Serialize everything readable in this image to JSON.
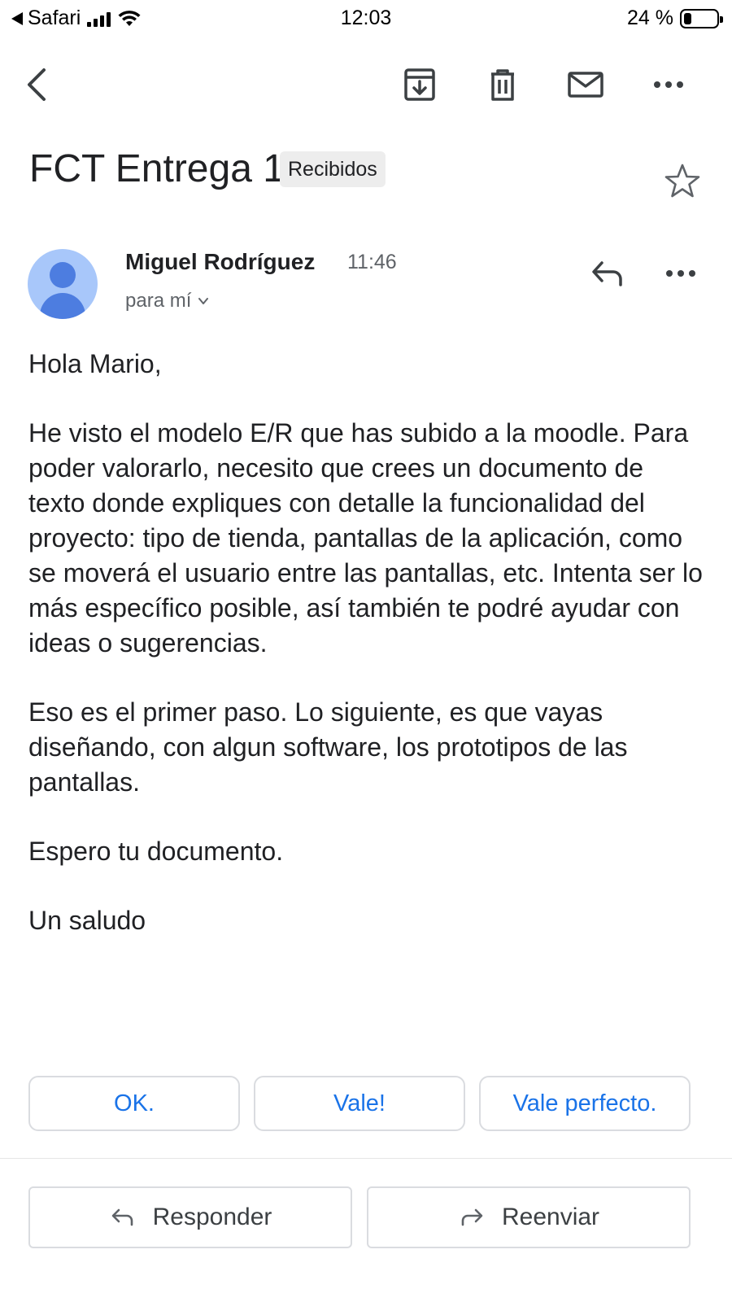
{
  "status_bar": {
    "back_app": "Safari",
    "time": "12:03",
    "battery_text": "24 %",
    "battery_level": 0.24
  },
  "toolbar": {
    "icons": [
      "back-arrow-icon",
      "archive-icon",
      "trash-icon",
      "mail-unread-icon",
      "more-options-icon"
    ]
  },
  "email": {
    "subject": "FCT Entrega 1",
    "label": "Recibidos",
    "starred": false,
    "sender_name": "Miguel Rodríguez",
    "time": "11:46",
    "recipient": "para mí",
    "body": [
      "Hola Mario,",
      "He visto el modelo E/R que has subido a la moodle. Para poder valorarlo, necesito que crees un documento de texto donde expliques con detalle la funcionalidad del proyecto: tipo de tienda, pantallas de la aplicación, como se moverá el usuario entre las pantallas, etc. Intenta ser lo más específico posible, así también te podré ayudar con ideas o sugerencias.",
      "Eso es el primer paso. Lo siguiente, es que vayas diseñando, con algun software, los prototipos de las pantallas.",
      "Espero tu documento.",
      "Un saludo"
    ]
  },
  "smart_replies": [
    "OK.",
    "Vale!",
    "Vale perfecto."
  ],
  "actions": {
    "reply": "Responder",
    "forward": "Reenviar"
  },
  "colors": {
    "accent": "#1a73e8",
    "avatar_bg": "#a8c7fa",
    "avatar_fg": "#4d7de0",
    "chip_bg": "#ededed"
  }
}
